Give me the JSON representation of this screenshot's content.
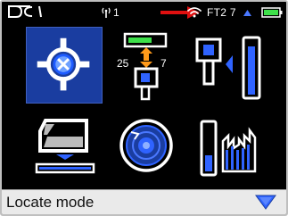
{
  "status": {
    "logo": "DCI",
    "antenna_value": "1",
    "ft_label": "FT2 7",
    "battery_icon": "battery-full-icon"
  },
  "menu": {
    "icons": [
      "locate-crosshair-icon",
      "depth-height-icon",
      "signal-strength-icon",
      "transmitter-calibration-icon",
      "target-steering-icon",
      "frequency-optimizer-icon"
    ],
    "height_left_value": "25",
    "height_right_value": "7"
  },
  "footer": {
    "mode_label": "Locate mode",
    "menu_arrow": "down-arrow-icon"
  },
  "colors": {
    "background": "#000000",
    "accent_blue": "#2f63ff",
    "highlight_blue": "#1a3da0",
    "battery_green": "#3ee04a",
    "orange": "#ff9a1a",
    "red_annotation": "#e01010"
  }
}
